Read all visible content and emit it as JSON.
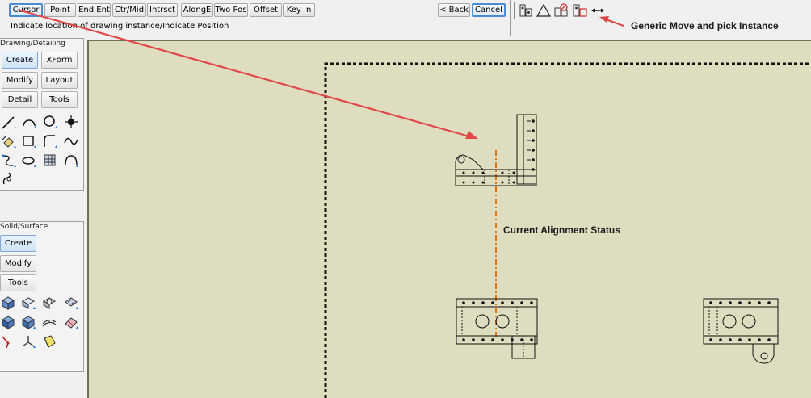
{
  "toolbar": {
    "buttons": [
      "Cursor",
      "Point",
      "End Ent",
      "Ctr/Mid",
      "Intrsct",
      "AlongE",
      "Two Pos",
      "Offset",
      "Key In"
    ],
    "back_label": "< Back",
    "cancel_label": "Cancel",
    "prompt": "Indicate location of drawing instance/Indicate Position"
  },
  "right_icons": [
    "instance-pick-icon",
    "triangle-icon",
    "no-entry-icon",
    "instance-move-icon",
    "horizontal-arrow-icon"
  ],
  "annotations": {
    "generic_move": "Generic Move and pick Instance",
    "alignment": "Current Alignment Status"
  },
  "drawing_panel": {
    "title": "Drawing/Detailing",
    "buttons": [
      "Create",
      "XForm",
      "Modify",
      "Layout",
      "Detail",
      "Tools"
    ]
  },
  "solid_panel": {
    "title": "Solid/Surface",
    "buttons": [
      "Create",
      "Modify",
      "Tools"
    ]
  },
  "colors": {
    "canvas": "#deddc0",
    "arrow": "#e04848",
    "alignment_line": "#e8740c",
    "selected_border": "#4a8bd6"
  }
}
